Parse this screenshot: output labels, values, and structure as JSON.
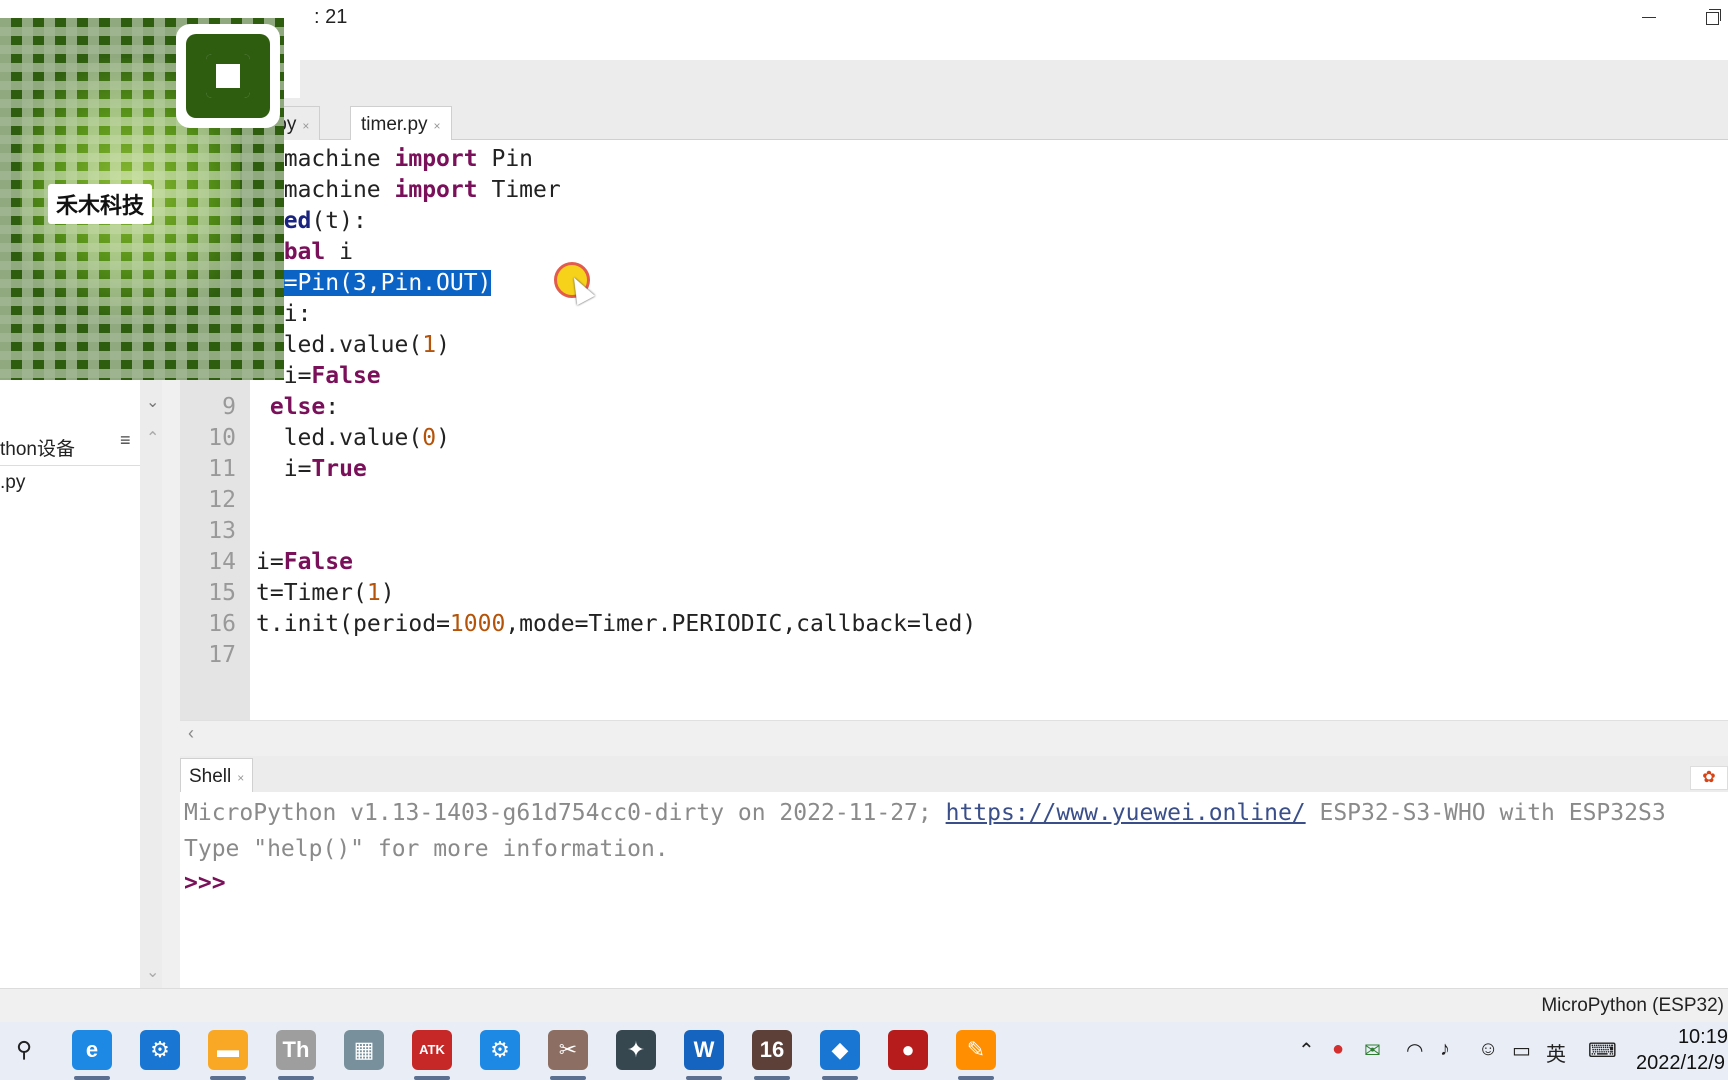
{
  "window": {
    "title_fragment": ": 21"
  },
  "editor_tabs": [
    {
      "label": ".py",
      "active": false
    },
    {
      "label": "timer.py",
      "active": true
    }
  ],
  "tab_close_glyph": "×",
  "code_lines": [
    {
      "n": "",
      "text": "m machine import Pin"
    },
    {
      "n": "",
      "text": "m machine import Timer"
    },
    {
      "n": "",
      "text": " led(t):"
    },
    {
      "n": "",
      "text": "lobal i"
    },
    {
      "n": "",
      "text": "ed=Pin(3,Pin.OUT)"
    },
    {
      "n": "",
      "text": "f i:"
    },
    {
      "n": "",
      "text": "  led.value(1)"
    },
    {
      "n": "",
      "text": "  i=False"
    },
    {
      "n": "9",
      "text": " else:"
    },
    {
      "n": "10",
      "text": "  led.value(0)"
    },
    {
      "n": "11",
      "text": "  i=True"
    },
    {
      "n": "12",
      "text": ""
    },
    {
      "n": "13",
      "text": ""
    },
    {
      "n": "14",
      "text": "i=False"
    },
    {
      "n": "15",
      "text": "t=Timer(1)"
    },
    {
      "n": "16",
      "text": "t.init(period=1000,mode=Timer.PERIODIC,callback=led)"
    },
    {
      "n": "17",
      "text": ""
    }
  ],
  "files_panel": {
    "header": "thon设备",
    "menu_glyph": "≡",
    "file": ".py"
  },
  "qr_overlay": {
    "label": "禾木科技"
  },
  "shell": {
    "tab_label": "Shell",
    "line1_prefix": "MicroPython v1.13-1403-g61d754cc0-dirty on 2022-11-27; ",
    "line1_link": "https://www.yuewei.online/",
    "line1_suffix": " ESP32-S3-WHO with ESP32S3",
    "line2": "Type \"help()\" for more information.",
    "prompt": ">>>"
  },
  "statusbar": {
    "interpreter": "MicroPython (ESP32)"
  },
  "taskbar": {
    "time": "10:19",
    "date": "2022/12/9",
    "ime": "英",
    "apps": [
      {
        "name": "search-icon",
        "glyph": "⚲",
        "color": "#e9eef6"
      },
      {
        "name": "edge-icon",
        "glyph": "e",
        "color": "#1e88e5"
      },
      {
        "name": "settings-icon",
        "glyph": "⚙",
        "color": "#1976d2"
      },
      {
        "name": "file-explorer-icon",
        "glyph": "▬",
        "color": "#f9a825"
      },
      {
        "name": "thonny-icon",
        "glyph": "Th",
        "color": "#9e9e9e"
      },
      {
        "name": "calculator-icon",
        "glyph": "▦",
        "color": "#78909c"
      },
      {
        "name": "atk-xcom-icon",
        "glyph": "ATK",
        "color": "#c62828"
      },
      {
        "name": "gear-app-icon",
        "glyph": "⚙",
        "color": "#1e88e5"
      },
      {
        "name": "tools-icon",
        "glyph": "✂",
        "color": "#8d6e63"
      },
      {
        "name": "bird-app-icon",
        "glyph": "✦",
        "color": "#37474f"
      },
      {
        "name": "word-icon",
        "glyph": "W",
        "color": "#1565c0"
      },
      {
        "name": "altium-icon",
        "glyph": "16",
        "color": "#5d4037"
      },
      {
        "name": "vscode-icon",
        "glyph": "◆",
        "color": "#1976d2"
      },
      {
        "name": "recorder-icon",
        "glyph": "●",
        "color": "#b71c1c"
      },
      {
        "name": "paint-icon",
        "glyph": "✎",
        "color": "#ff8f00"
      }
    ]
  }
}
